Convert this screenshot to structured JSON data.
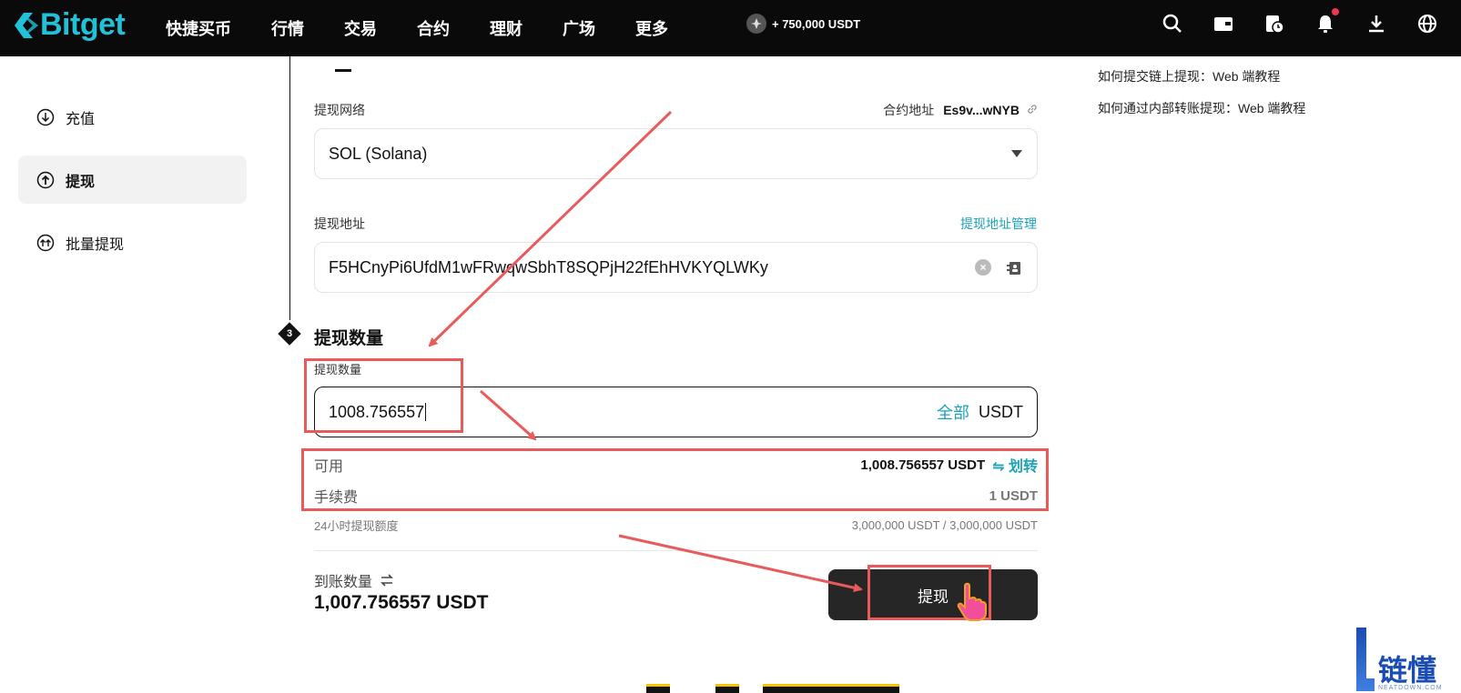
{
  "nav": {
    "logo": "Bitget",
    "items": [
      "快捷买币",
      "行情",
      "交易",
      "合约",
      "理财",
      "广场",
      "更多"
    ],
    "promo": "+ 750,000 USDT"
  },
  "sidebar": {
    "items": [
      {
        "label": "充值",
        "icon": "deposit-icon"
      },
      {
        "label": "提现",
        "icon": "withdraw-icon",
        "active": true
      },
      {
        "label": "批量提现",
        "icon": "batch-withdraw-icon"
      }
    ]
  },
  "form": {
    "network_label": "提现网络",
    "contract_label": "合约地址",
    "contract_value": "Es9v...wNYB",
    "network_value": "SOL (Solana)",
    "address_label": "提现地址",
    "address_manage": "提现地址管理",
    "address_value": "F5HCnyPi6UfdM1wFRwqwSbhT8SQPjH22fEhHVKYQLWKy",
    "step_number": "3",
    "amount_section_title": "提现数量",
    "amount_label": "提现数量",
    "amount_value": "1008.756557",
    "all_label": "全部",
    "currency": "USDT",
    "available_label": "可用",
    "available_value": "1,008.756557 USDT",
    "transfer_label": "⇋ 划转",
    "fee_label": "手续费",
    "fee_value": "1 USDT",
    "limit_label": "24小时提现额度",
    "limit_value": "3,000,000 USDT / 3,000,000 USDT",
    "receive_label": "到账数量",
    "receive_value": "1,007.756557 USDT",
    "submit_label": "提现"
  },
  "help": {
    "links": [
      "如何提交链上提现：Web 端教程",
      "如何通过内部转账提现：Web 端教程"
    ]
  },
  "watermark": {
    "text": "链懂",
    "sub": "NEATDOWN.COM"
  },
  "colors": {
    "accent": "#1ca3b8",
    "annotation": "#e95b5b",
    "nav_bg": "#0a0a0a"
  }
}
